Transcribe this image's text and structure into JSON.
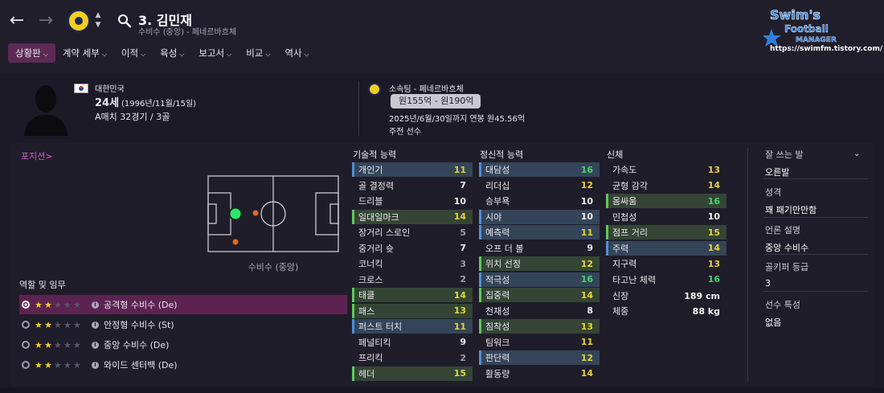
{
  "header": {
    "player_name": "3. 김민재",
    "player_sub": "수비수 (중앙) - 페네르바흐체",
    "tabs": [
      {
        "label": "상황판"
      },
      {
        "label": "계약 세부"
      },
      {
        "label": "이적"
      },
      {
        "label": "육성"
      },
      {
        "label": "보고서"
      },
      {
        "label": "비교"
      },
      {
        "label": "역사"
      }
    ],
    "logo_text": "Swim's Football MANAGER",
    "logo_url": "https://swimfm.tistory.com/"
  },
  "profile": {
    "nation": "대한민국",
    "age": "24세",
    "dob": "(1996년/11월/15일)",
    "caps": "A매치 32경기 / 3골",
    "club": "소속팀 - 페네르바흐체",
    "value": "원155억 - 원190억",
    "contract": "2025년/6월/30일까지 연봉 원45.56억",
    "status": "주전 선수"
  },
  "position": {
    "link": "포지션",
    "caption": "수비수 (중앙)"
  },
  "roles": {
    "title": "역할 및 임무",
    "items": [
      {
        "name": "공격형 수비수 (De)",
        "stars": 2,
        "active": true
      },
      {
        "name": "안정형 수비수 (St)",
        "stars": 2,
        "active": false
      },
      {
        "name": "중앙 수비수 (De)",
        "stars": 2,
        "active": false
      },
      {
        "name": "와이드 센터백 (De)",
        "stars": 2,
        "active": false
      }
    ]
  },
  "technical": {
    "title": "기술적 능력",
    "items": [
      {
        "name": "개인기",
        "value": "11",
        "hl": "blue",
        "color": "yellow"
      },
      {
        "name": "골 결정력",
        "value": "7",
        "hl": "",
        "color": "white"
      },
      {
        "name": "드리블",
        "value": "10",
        "hl": "",
        "color": "white"
      },
      {
        "name": "일대일마크",
        "value": "14",
        "hl": "green",
        "color": "yellow"
      },
      {
        "name": "장거리 스로인",
        "value": "5",
        "hl": "",
        "color": "grey"
      },
      {
        "name": "중거리 슛",
        "value": "7",
        "hl": "",
        "color": "white"
      },
      {
        "name": "코너킥",
        "value": "3",
        "hl": "",
        "color": "grey"
      },
      {
        "name": "크로스",
        "value": "2",
        "hl": "",
        "color": "grey"
      },
      {
        "name": "태클",
        "value": "14",
        "hl": "green",
        "color": "yellow"
      },
      {
        "name": "패스",
        "value": "13",
        "hl": "green",
        "color": "yellow"
      },
      {
        "name": "퍼스트 터치",
        "value": "11",
        "hl": "blue",
        "color": "yellow"
      },
      {
        "name": "페널티킥",
        "value": "9",
        "hl": "",
        "color": "white"
      },
      {
        "name": "프리킥",
        "value": "2",
        "hl": "",
        "color": "grey"
      },
      {
        "name": "헤더",
        "value": "15",
        "hl": "green",
        "color": "yellow"
      }
    ]
  },
  "mental": {
    "title": "정신적 능력",
    "items": [
      {
        "name": "대담성",
        "value": "16",
        "hl": "blue",
        "color": "green"
      },
      {
        "name": "리더십",
        "value": "12",
        "hl": "",
        "color": "yellow"
      },
      {
        "name": "승부욕",
        "value": "10",
        "hl": "",
        "color": "white"
      },
      {
        "name": "시야",
        "value": "10",
        "hl": "blue",
        "color": "white"
      },
      {
        "name": "예측력",
        "value": "11",
        "hl": "blue",
        "color": "yellow"
      },
      {
        "name": "오프 더 볼",
        "value": "9",
        "hl": "",
        "color": "white"
      },
      {
        "name": "위치 선정",
        "value": "12",
        "hl": "green",
        "color": "yellow"
      },
      {
        "name": "적극성",
        "value": "16",
        "hl": "blue",
        "color": "green"
      },
      {
        "name": "집중력",
        "value": "14",
        "hl": "green",
        "color": "yellow"
      },
      {
        "name": "천재성",
        "value": "8",
        "hl": "",
        "color": "white"
      },
      {
        "name": "침착성",
        "value": "13",
        "hl": "green",
        "color": "yellow"
      },
      {
        "name": "팀워크",
        "value": "11",
        "hl": "",
        "color": "yellow"
      },
      {
        "name": "판단력",
        "value": "12",
        "hl": "blue",
        "color": "yellow"
      },
      {
        "name": "활동량",
        "value": "14",
        "hl": "",
        "color": "yellow"
      }
    ]
  },
  "physical": {
    "title": "신체",
    "items": [
      {
        "name": "가속도",
        "value": "13",
        "hl": "",
        "color": "yellow"
      },
      {
        "name": "균형 감각",
        "value": "14",
        "hl": "",
        "color": "yellow"
      },
      {
        "name": "몸싸움",
        "value": "16",
        "hl": "green",
        "color": "green"
      },
      {
        "name": "민첩성",
        "value": "10",
        "hl": "",
        "color": "white"
      },
      {
        "name": "점프 거리",
        "value": "15",
        "hl": "green",
        "color": "yellow"
      },
      {
        "name": "주력",
        "value": "14",
        "hl": "blue",
        "color": "yellow"
      },
      {
        "name": "지구력",
        "value": "13",
        "hl": "",
        "color": "yellow"
      },
      {
        "name": "타고난 체력",
        "value": "16",
        "hl": "",
        "color": "green"
      }
    ],
    "height_label": "신장",
    "height_value": "189 cm",
    "weight_label": "체중",
    "weight_value": "88 kg"
  },
  "side": {
    "foot_label": "잘 쓰는 발",
    "foot_value": "오른발",
    "personality_label": "성격",
    "personality_value": "꽤 패기만만함",
    "media_label": "언론 설명",
    "media_value": "중앙 수비수",
    "gk_label": "골키퍼 등급",
    "gk_value": "3",
    "traits_label": "선수 특성",
    "traits_value": "없음"
  },
  "colors": {
    "accent": "#5c2a55",
    "value_green": "#46d46a",
    "value_yellow": "#e6d23a",
    "link_pink": "#d65bcc"
  },
  "icons": [
    "back-arrow-icon",
    "forward-arrow-icon",
    "club-badge-icon",
    "search-icon",
    "chevron-down-icon",
    "info-icon",
    "star-icon",
    "flag-icon"
  ]
}
